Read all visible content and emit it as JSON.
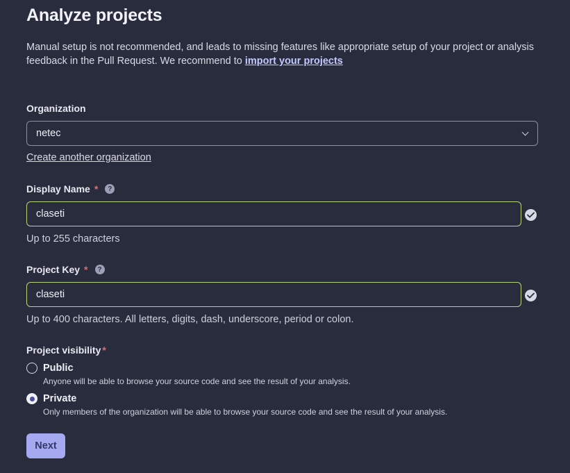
{
  "page": {
    "title": "Analyze projects",
    "intro_text": "Manual setup is not recommended, and leads to missing features like appropriate setup of your project or analysis feedback in the Pull Request. We recommend to ",
    "intro_link": "import your projects"
  },
  "organization": {
    "label": "Organization",
    "selected": "netec",
    "create_link": "Create another organization"
  },
  "display_name": {
    "label": "Display Name",
    "required_mark": "*",
    "help": "?",
    "value": "claseti",
    "hint": "Up to 255 characters"
  },
  "project_key": {
    "label": "Project Key",
    "required_mark": "*",
    "help": "?",
    "value": "claseti",
    "hint": "Up to 400 characters. All letters, digits, dash, underscore, period or colon."
  },
  "visibility": {
    "label": "Project visibility",
    "required_mark": "*",
    "options": [
      {
        "title": "Public",
        "description": "Anyone will be able to browse your source code and see the result of your analysis.",
        "checked": false
      },
      {
        "title": "Private",
        "description": "Only members of the organization will be able to browse your source code and see the result of your analysis.",
        "checked": true
      }
    ]
  },
  "actions": {
    "next_label": "Next"
  },
  "colors": {
    "background": "#292c3d",
    "valid_border": "#b9d67a",
    "primary_button": "#a5a9ef",
    "required": "#e46b6b"
  }
}
